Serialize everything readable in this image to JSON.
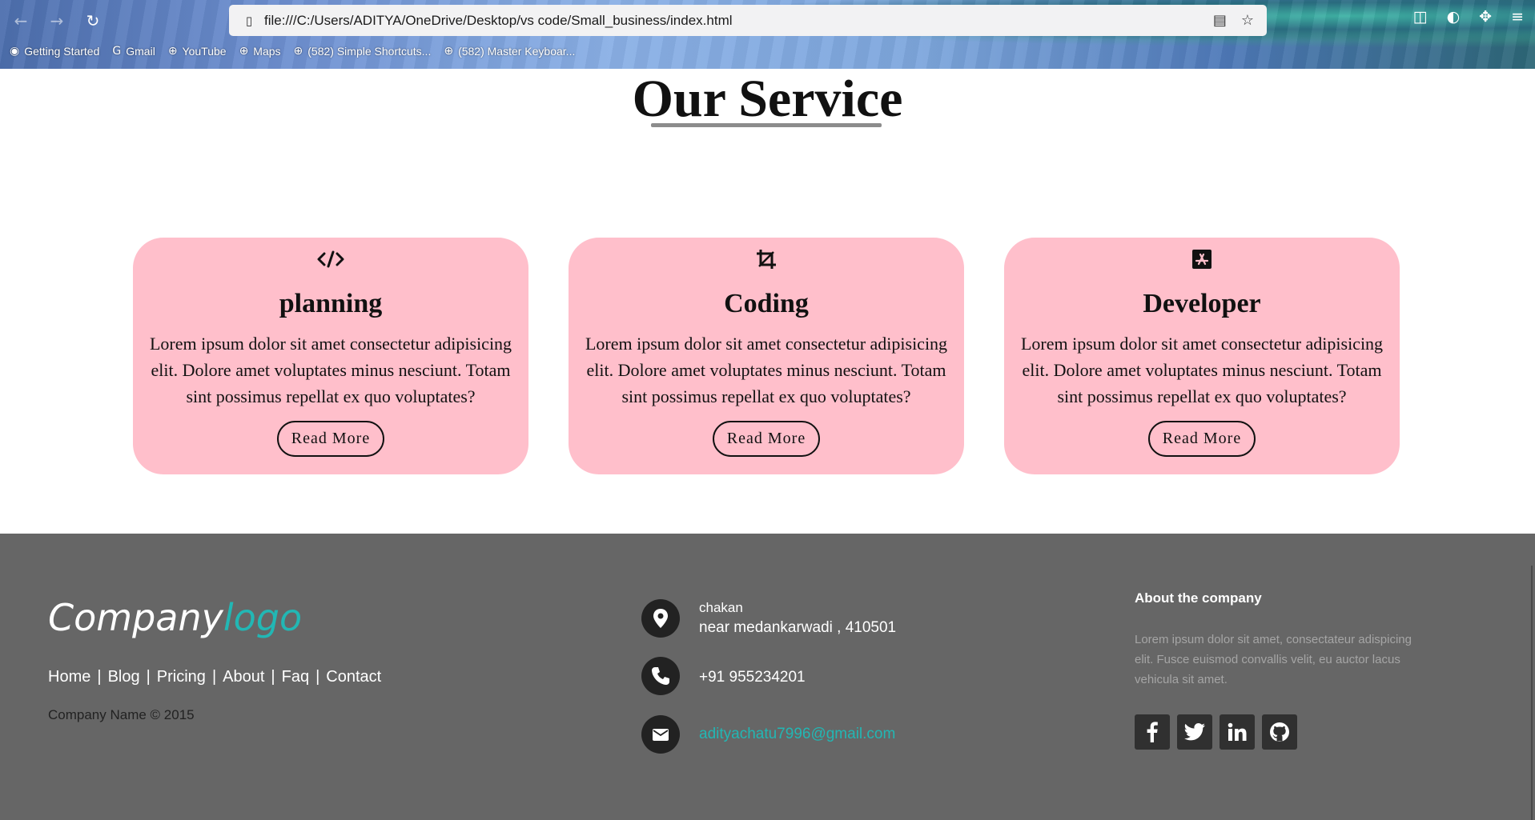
{
  "browser": {
    "url": "file:///C:/Users/ADITYA/OneDrive/Desktop/vs code/Small_business/index.html",
    "bookmarks": [
      {
        "label": "Getting Started",
        "icon": "firefox-icon"
      },
      {
        "label": "Gmail",
        "icon": "google-icon"
      },
      {
        "label": "YouTube",
        "icon": "globe-icon"
      },
      {
        "label": "Maps",
        "icon": "globe-icon"
      },
      {
        "label": "(582) Simple Shortcuts...",
        "icon": "globe-icon"
      },
      {
        "label": "(582) Master Keyboar...",
        "icon": "globe-icon"
      }
    ]
  },
  "section": {
    "title": "Our Service"
  },
  "cards": [
    {
      "icon": "code-icon",
      "title": "planning",
      "text": "Lorem ipsum dolor sit amet consectetur adipisicing elit. Dolore amet voluptates minus nesciunt. Totam sint possimus repellat ex quo voluptates?",
      "button": "Read More"
    },
    {
      "icon": "crop-icon",
      "title": "Coding",
      "text": "Lorem ipsum dolor sit amet consectetur adipisicing elit. Dolore amet voluptates minus nesciunt. Totam sint possimus repellat ex quo voluptates?",
      "button": "Read More"
    },
    {
      "icon": "app-store-icon",
      "title": "Developer",
      "text": "Lorem ipsum dolor sit amet consectetur adipisicing elit. Dolore amet voluptates minus nesciunt. Totam sint possimus repellat ex quo voluptates?",
      "button": "Read More"
    }
  ],
  "footer": {
    "logo_part1": "Company",
    "logo_part2": "logo",
    "links": [
      "Home",
      "Blog",
      "Pricing",
      "About",
      "Faq",
      "Contact"
    ],
    "copyright": "Company Name © 2015",
    "address_line1": "chakan",
    "address_line2": "near medankarwadi , 410501",
    "phone": "+91 955234201",
    "email": "adityachatu7996@gmail.com",
    "about_title": "About the company",
    "about_text": "Lorem ipsum dolor sit amet, consectateur adispicing elit. Fusce euismod convallis velit, eu auctor lacus vehicula sit amet.",
    "socials": [
      "facebook-icon",
      "twitter-icon",
      "linkedin-icon",
      "github-icon"
    ]
  },
  "colors": {
    "card_bg": "#ffbfcb",
    "footer_bg": "#666666",
    "accent": "#22b7b4"
  }
}
